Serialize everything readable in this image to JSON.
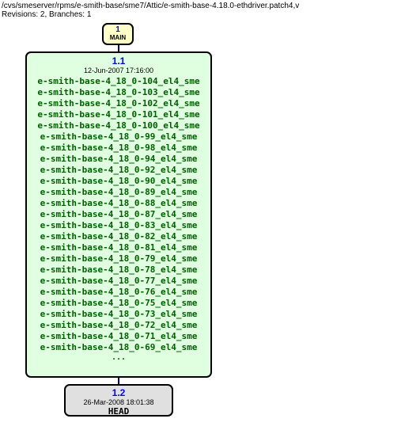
{
  "header": {
    "path": "/cvs/smeserver/rpms/e-smith-base/sme7/Attic/e-smith-base-4.18.0-ethdriver.patch4,v",
    "summary": "Revisions: 2, Branches: 1"
  },
  "main_node": {
    "number": "1",
    "label": "MAIN"
  },
  "big_node": {
    "version": "1.1",
    "date": "12-Jun-2007 17:16:00",
    "tags": [
      "e-smith-base-4_18_0-104_el4_sme",
      "e-smith-base-4_18_0-103_el4_sme",
      "e-smith-base-4_18_0-102_el4_sme",
      "e-smith-base-4_18_0-101_el4_sme",
      "e-smith-base-4_18_0-100_el4_sme",
      "e-smith-base-4_18_0-99_el4_sme",
      "e-smith-base-4_18_0-98_el4_sme",
      "e-smith-base-4_18_0-94_el4_sme",
      "e-smith-base-4_18_0-92_el4_sme",
      "e-smith-base-4_18_0-90_el4_sme",
      "e-smith-base-4_18_0-89_el4_sme",
      "e-smith-base-4_18_0-88_el4_sme",
      "e-smith-base-4_18_0-87_el4_sme",
      "e-smith-base-4_18_0-83_el4_sme",
      "e-smith-base-4_18_0-82_el4_sme",
      "e-smith-base-4_18_0-81_el4_sme",
      "e-smith-base-4_18_0-79_el4_sme",
      "e-smith-base-4_18_0-78_el4_sme",
      "e-smith-base-4_18_0-77_el4_sme",
      "e-smith-base-4_18_0-76_el4_sme",
      "e-smith-base-4_18_0-75_el4_sme",
      "e-smith-base-4_18_0-73_el4_sme",
      "e-smith-base-4_18_0-72_el4_sme",
      "e-smith-base-4_18_0-71_el4_sme",
      "e-smith-base-4_18_0-69_el4_sme"
    ],
    "ellipsis": "..."
  },
  "head_node": {
    "version": "1.2",
    "date": "26-Mar-2008 18:01:38",
    "label": "HEAD"
  },
  "chart_data": {
    "type": "graph",
    "description": "CVS revision tree",
    "nodes": [
      {
        "id": "MAIN",
        "label": "1",
        "sublabel": "MAIN"
      },
      {
        "id": "1.1",
        "label": "1.1",
        "date": "12-Jun-2007 17:16:00",
        "tag_count": 25,
        "truncated": true
      },
      {
        "id": "1.2",
        "label": "1.2",
        "date": "26-Mar-2008 18:01:38",
        "head": true
      }
    ],
    "edges": [
      {
        "from": "MAIN",
        "to": "1.1"
      },
      {
        "from": "1.1",
        "to": "1.2"
      }
    ]
  }
}
